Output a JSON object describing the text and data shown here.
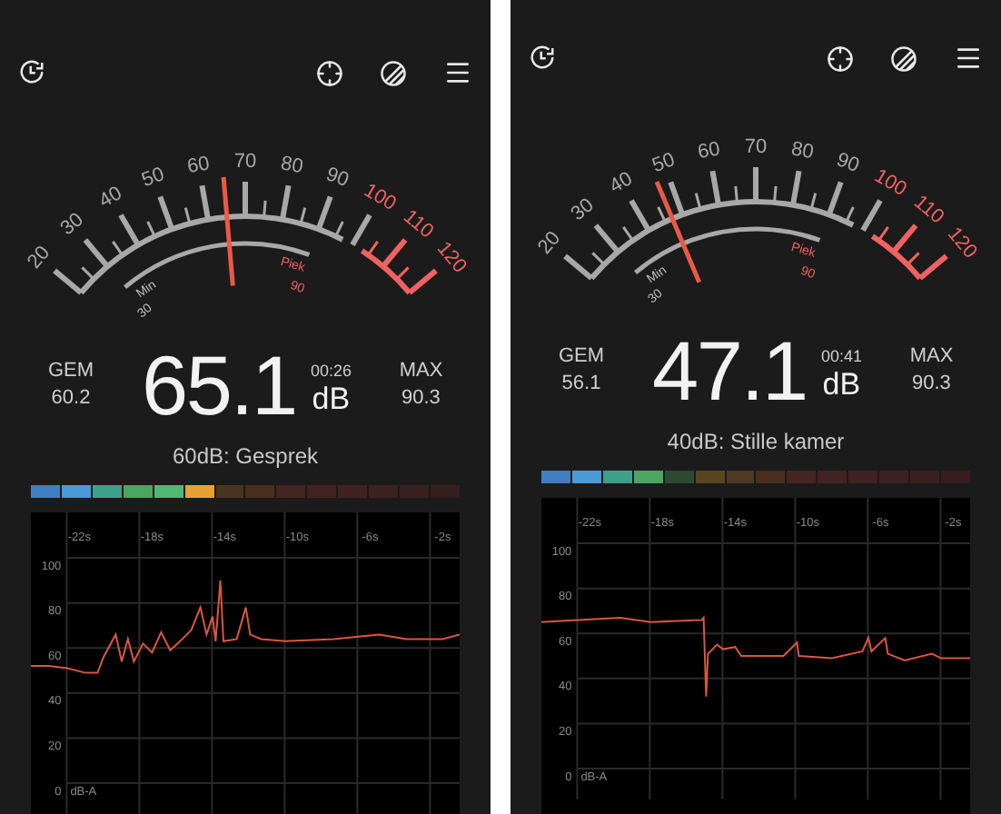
{
  "screens": [
    {
      "gauge": {
        "level": 0.451,
        "ticks": [
          {
            "label": "20",
            "danger": false
          },
          {
            "label": "30",
            "danger": false
          },
          {
            "label": "40",
            "danger": false
          },
          {
            "label": "50",
            "danger": false
          },
          {
            "label": "60",
            "danger": false
          },
          {
            "label": "70",
            "danger": false
          },
          {
            "label": "80",
            "danger": false
          },
          {
            "label": "90",
            "danger": false
          },
          {
            "label": "100",
            "danger": true
          },
          {
            "label": "110",
            "danger": true
          },
          {
            "label": "120",
            "danger": true
          }
        ],
        "min_label": "Min",
        "min_value": "30",
        "peak_label": "Piek",
        "peak_value": "90"
      },
      "avg_label": "GEM",
      "avg_value": "60.2",
      "value": "65.1",
      "duration": "00:26",
      "unit": "dB",
      "max_label": "MAX",
      "max_value": "90.3",
      "description": "60dB: Gesprek",
      "segments": [
        {
          "color": "#3f7fbf"
        },
        {
          "color": "#4a9ad8"
        },
        {
          "color": "#3fa08a"
        },
        {
          "color": "#4aa660"
        },
        {
          "color": "#50b872"
        },
        {
          "color": "#e8a030"
        },
        {
          "color": "#4a3520"
        },
        {
          "color": "#4a2e1c"
        },
        {
          "color": "#452522"
        },
        {
          "color": "#422322"
        },
        {
          "color": "#402222"
        },
        {
          "color": "#3d2020"
        },
        {
          "color": "#3a1f1f"
        },
        {
          "color": "#361e1e"
        }
      ],
      "chart_data": {
        "type": "line",
        "ylabel": "dB-A",
        "grid": true,
        "x": [
          -24.67,
          -23.67,
          -22.67,
          -21.67,
          -21.0,
          -20.67,
          -20.0,
          -19.67,
          -19.33,
          -19.0,
          -18.5,
          -18.0,
          -17.5,
          -17.0,
          -16.33,
          -15.84,
          -15.34,
          -15.0,
          -14.67,
          -14.5,
          -14.24,
          -14.07,
          -13.34,
          -12.84,
          -12.6,
          -12.0,
          -10.67,
          -8.0,
          -5.5,
          -4.0,
          -2.0,
          -1.07
        ],
        "series": [
          {
            "color": "#d9573f",
            "values": [
              52,
              52,
              51,
              49,
              49,
              56,
              66,
              54,
              64,
              54,
              62,
              58,
              67,
              59,
              64,
              68,
              78,
              66,
              74,
              63,
              90,
              63,
              64,
              78,
              66,
              64,
              63,
              64,
              66,
              64,
              64,
              66
            ]
          }
        ],
        "xlim": [
          -24.67,
          -1.07
        ],
        "ylim": [
          -13.7,
          120.2
        ],
        "xticks": [
          {
            "value": -22,
            "label": "-22s"
          },
          {
            "value": -18,
            "label": "-18s"
          },
          {
            "value": -14,
            "label": "-14s"
          },
          {
            "value": -10,
            "label": "-10s"
          },
          {
            "value": -6,
            "label": "-6s"
          },
          {
            "value": -2,
            "label": "-2s"
          }
        ],
        "yticks": [
          0,
          20,
          40,
          60,
          80,
          100
        ]
      }
    },
    {
      "gauge": {
        "level": 0.271,
        "ticks": [
          {
            "label": "20",
            "danger": false
          },
          {
            "label": "30",
            "danger": false
          },
          {
            "label": "40",
            "danger": false
          },
          {
            "label": "50",
            "danger": false
          },
          {
            "label": "60",
            "danger": false
          },
          {
            "label": "70",
            "danger": false
          },
          {
            "label": "80",
            "danger": false
          },
          {
            "label": "90",
            "danger": false
          },
          {
            "label": "100",
            "danger": true
          },
          {
            "label": "110",
            "danger": true
          },
          {
            "label": "120",
            "danger": true
          }
        ],
        "min_label": "Min",
        "min_value": "30",
        "peak_label": "Piek",
        "peak_value": "90"
      },
      "avg_label": "GEM",
      "avg_value": "56.1",
      "value": "47.1",
      "duration": "00:41",
      "unit": "dB",
      "max_label": "MAX",
      "max_value": "90.3",
      "description": "40dB: Stille kamer",
      "segments": [
        {
          "color": "#3f7fbf"
        },
        {
          "color": "#4a9ad8"
        },
        {
          "color": "#3fa08a"
        },
        {
          "color": "#4aa660"
        },
        {
          "color": "#2a4a32"
        },
        {
          "color": "#5a4520"
        },
        {
          "color": "#4e3a22"
        },
        {
          "color": "#4a2e1c"
        },
        {
          "color": "#452522"
        },
        {
          "color": "#422322"
        },
        {
          "color": "#402222"
        },
        {
          "color": "#3d2020"
        },
        {
          "color": "#3a1f1f"
        },
        {
          "color": "#361e1e"
        }
      ],
      "chart_data": {
        "type": "line",
        "ylabel": "dB-A",
        "grid": true,
        "x": [
          -24.67,
          -22.67,
          -20.33,
          -18.67,
          -15.84,
          -15.74,
          -15.6,
          -15.5,
          -15.0,
          -14.67,
          -14.0,
          -13.67,
          -11.34,
          -10.6,
          -10.5,
          -8.67,
          -7.0,
          -6.67,
          -6.5,
          -5.74,
          -5.6,
          -4.67,
          -3.17,
          -2.67,
          -1.07
        ],
        "series": [
          {
            "color": "#d9573f",
            "values": [
              65,
              66,
              67,
              65,
              66,
              67,
              32,
              51,
              55,
              53,
              54,
              50,
              50,
              56,
              50,
              49,
              52,
              58,
              52,
              58,
              51,
              48,
              51,
              49,
              49
            ]
          }
        ],
        "xlim": [
          -24.67,
          -1.07
        ],
        "ylim": [
          -13.7,
          120.2
        ],
        "xticks": [
          {
            "value": -22,
            "label": "-22s"
          },
          {
            "value": -18,
            "label": "-18s"
          },
          {
            "value": -14,
            "label": "-14s"
          },
          {
            "value": -10,
            "label": "-10s"
          },
          {
            "value": -6,
            "label": "-6s"
          },
          {
            "value": -2,
            "label": "-2s"
          }
        ],
        "yticks": [
          0,
          20,
          40,
          60,
          80,
          100
        ]
      }
    }
  ]
}
